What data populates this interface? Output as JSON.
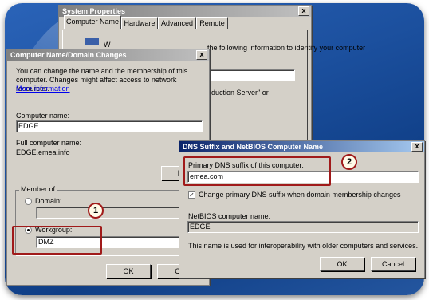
{
  "system_props": {
    "title": "System Properties",
    "close": "x",
    "tabs": [
      "Computer Name",
      "Hardware",
      "Advanced",
      "Remote"
    ],
    "desc_partial": "the following information to identify your computer",
    "desc_w": "W",
    "prod_partial": "oduction Server\" or"
  },
  "cn_dialog": {
    "title": "Computer Name/Domain Changes",
    "close": "x",
    "desc": "You can change the name and the membership of this computer. Changes might affect access to network resources.",
    "more_info": "More information",
    "computer_name_label": "Computer name:",
    "computer_name_value": "EDGE",
    "full_name_label": "Full computer name:",
    "full_name_value": "EDGE.emea.info",
    "more_button": "Mo",
    "member_of_label": "Member of",
    "domain_label": "Domain:",
    "domain_value": "",
    "workgroup_label": "Workgroup:",
    "workgroup_value": "DMZ",
    "ok": "OK",
    "cancel": "Ca"
  },
  "dns_dialog": {
    "title": "DNS Suffix and NetBIOS Computer Name",
    "close": "x",
    "primary_label": "Primary DNS suffix of this computer:",
    "primary_value": "emea.com",
    "check_label": "Change primary DNS suffix when domain membership changes",
    "checked_mark": "✓",
    "netbios_label": "NetBIOS computer name:",
    "netbios_value": "EDGE",
    "note": "This name is used for interoperability with older computers and services.",
    "ok": "OK",
    "cancel": "Cancel"
  },
  "callouts": {
    "one": "1",
    "two": "2"
  },
  "colors": {
    "highlight": "#a01a1a",
    "title_active": "#0a246a",
    "background": "#1b4f9d"
  }
}
